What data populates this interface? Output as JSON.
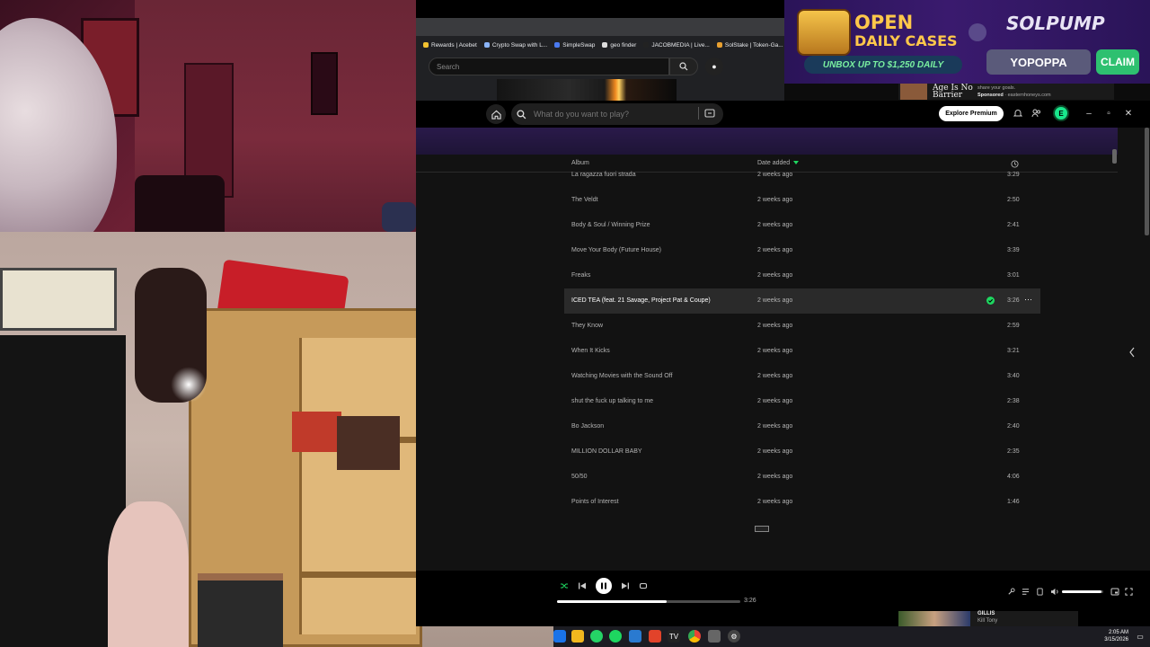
{
  "browser": {
    "bookmarks": [
      {
        "label": "Rewards | Acebet",
        "color": "#f2c230"
      },
      {
        "label": "Crypto Swap with L...",
        "color": "#8ab4f8"
      },
      {
        "label": "SimpleSwap",
        "color": "#4a7af0"
      },
      {
        "label": "geo finder",
        "color": "#dddddd"
      },
      {
        "label": "JACOBMEDIA | Live...",
        "color": "#222222"
      },
      {
        "label": "SolStake | Token-Ga...",
        "color": "#e8a030"
      }
    ],
    "search_placeholder": "Search"
  },
  "ad": {
    "headline_1": "OPEN",
    "headline_2": "DAILY CASES",
    "subline": "UNBOX UP TO $1,250 DAILY",
    "brand": "SOLPUMP",
    "username": "YOPOPPA",
    "cta": "CLAIM"
  },
  "side_ad": {
    "headline": "Age Is No Barrier",
    "line1": "share your goals.",
    "sponsored": "Sponsored",
    "domain": "· easternhoneys.com"
  },
  "spotify": {
    "search_placeholder": "What do you want to play?",
    "explore_premium": "Explore Premium",
    "avatar_letter": "E",
    "columns": {
      "album": "Album",
      "date_added": "Date added"
    },
    "tracks": [
      {
        "album": "La ragazza fuori strada",
        "date": "2 weeks ago",
        "duration": "3:29"
      },
      {
        "album": "The Veldt",
        "date": "2 weeks ago",
        "duration": "2:50"
      },
      {
        "album": "Body & Soul / Winning Prize",
        "date": "2 weeks ago",
        "duration": "2:41"
      },
      {
        "album": "Move Your Body (Future House)",
        "date": "2 weeks ago",
        "duration": "3:39"
      },
      {
        "album": "Freaks",
        "date": "2 weeks ago",
        "duration": "3:01"
      },
      {
        "album": "ICED TEA (feat. 21 Savage, Project Pat & Coupe)",
        "date": "2 weeks ago",
        "duration": "3:26",
        "active": true
      },
      {
        "album": "They Know",
        "date": "2 weeks ago",
        "duration": "2:59"
      },
      {
        "album": "When It Kicks",
        "date": "2 weeks ago",
        "duration": "3:21"
      },
      {
        "album": "Watching Movies with the Sound Off",
        "date": "2 weeks ago",
        "duration": "3:40"
      },
      {
        "album": "shut the fuck up talking to me",
        "date": "2 weeks ago",
        "duration": "2:38"
      },
      {
        "album": "Bo Jackson",
        "date": "2 weeks ago",
        "duration": "2:40"
      },
      {
        "album": "MILLION DOLLAR BABY",
        "date": "2 weeks ago",
        "duration": "2:35"
      },
      {
        "album": "50/50",
        "date": "2 weeks ago",
        "duration": "4:06"
      },
      {
        "album": "Points of Interest",
        "date": "2 weeks ago",
        "duration": "1:46"
      }
    ],
    "player": {
      "total_time": "3:26",
      "progress": 0.6,
      "volume": 0.95
    }
  },
  "side_ad_bottom": {
    "title": "GILLIS",
    "subtitle": "Kill Tony"
  },
  "taskbar": {
    "time": "2:05 AM",
    "date": "3/15/2026"
  }
}
